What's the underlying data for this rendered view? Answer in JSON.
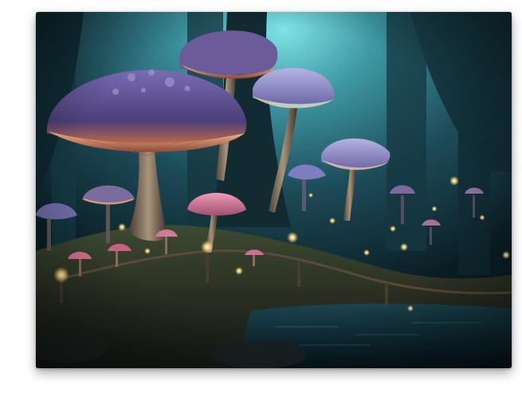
{
  "artwork": {
    "subject": "glowing-mushroom-forest",
    "format": "canvas-print",
    "colors": {
      "page_background": "#ffffff",
      "sky_glow": "#6fd3da",
      "forest_teal": "#1c4a55",
      "deep_shadow": "#0a1b22",
      "cap_violet": "#6a5aa0",
      "cap_glow_orange": "#e08a55",
      "cap_pink": "#d4708e",
      "firefly": "#ffe9a0",
      "moss": "#4b4a2a",
      "water": "#0c2530"
    }
  }
}
